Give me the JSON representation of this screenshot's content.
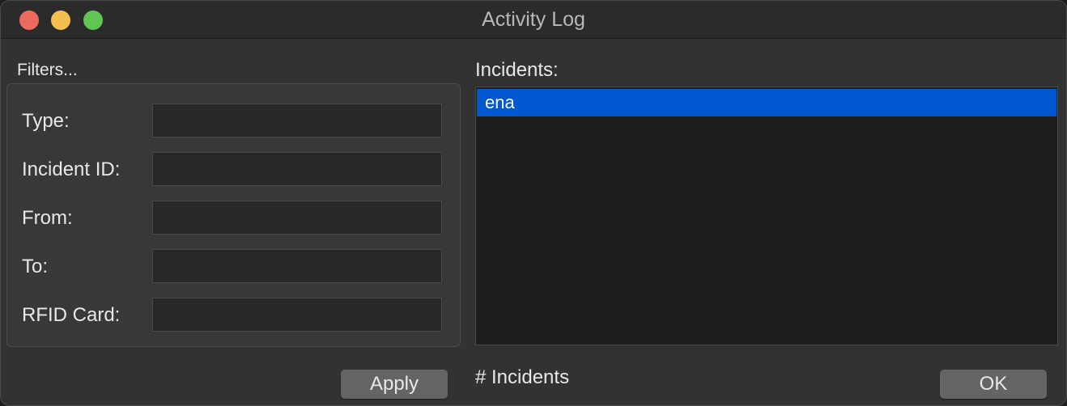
{
  "window": {
    "title": "Activity Log"
  },
  "filters": {
    "group_label": "Filters...",
    "fields": [
      {
        "label": "Type:",
        "value": ""
      },
      {
        "label": "Incident ID:",
        "value": ""
      },
      {
        "label": "From:",
        "value": ""
      },
      {
        "label": "To:",
        "value": ""
      },
      {
        "label": "RFID Card:",
        "value": ""
      }
    ],
    "apply_label": "Apply"
  },
  "incidents": {
    "label": "Incidents:",
    "items": [
      "ena"
    ],
    "selected": "ena",
    "count_label": "# Incidents"
  },
  "ok_label": "OK",
  "colors": {
    "selection": "#0058d0",
    "close": "#ed6a5e",
    "minimize": "#f4bf4f",
    "zoom": "#61c554"
  }
}
